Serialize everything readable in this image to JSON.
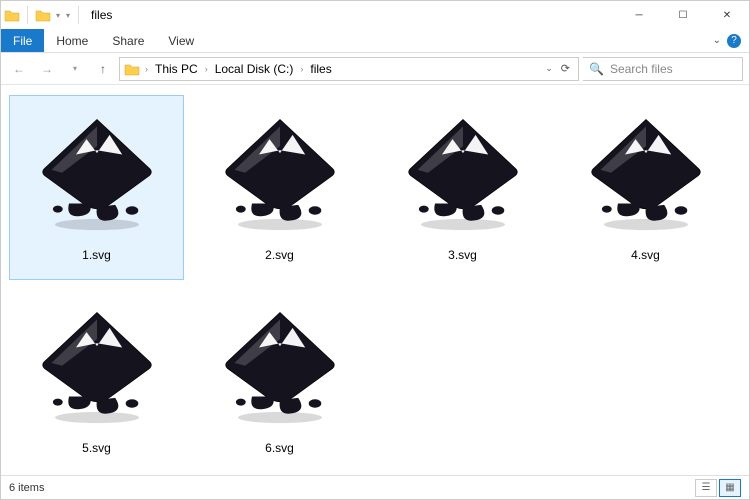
{
  "titlebar": {
    "title": "files"
  },
  "ribbon": {
    "file": "File",
    "home": "Home",
    "share": "Share",
    "view": "View"
  },
  "nav": {
    "breadcrumbs": [
      "This PC",
      "Local Disk (C:)",
      "files"
    ],
    "search_placeholder": "Search files"
  },
  "files": [
    {
      "name": "1.svg",
      "selected": true
    },
    {
      "name": "2.svg",
      "selected": false
    },
    {
      "name": "3.svg",
      "selected": false
    },
    {
      "name": "4.svg",
      "selected": false
    },
    {
      "name": "5.svg",
      "selected": false
    },
    {
      "name": "6.svg",
      "selected": false
    }
  ],
  "status": {
    "count_text": "6 items"
  }
}
